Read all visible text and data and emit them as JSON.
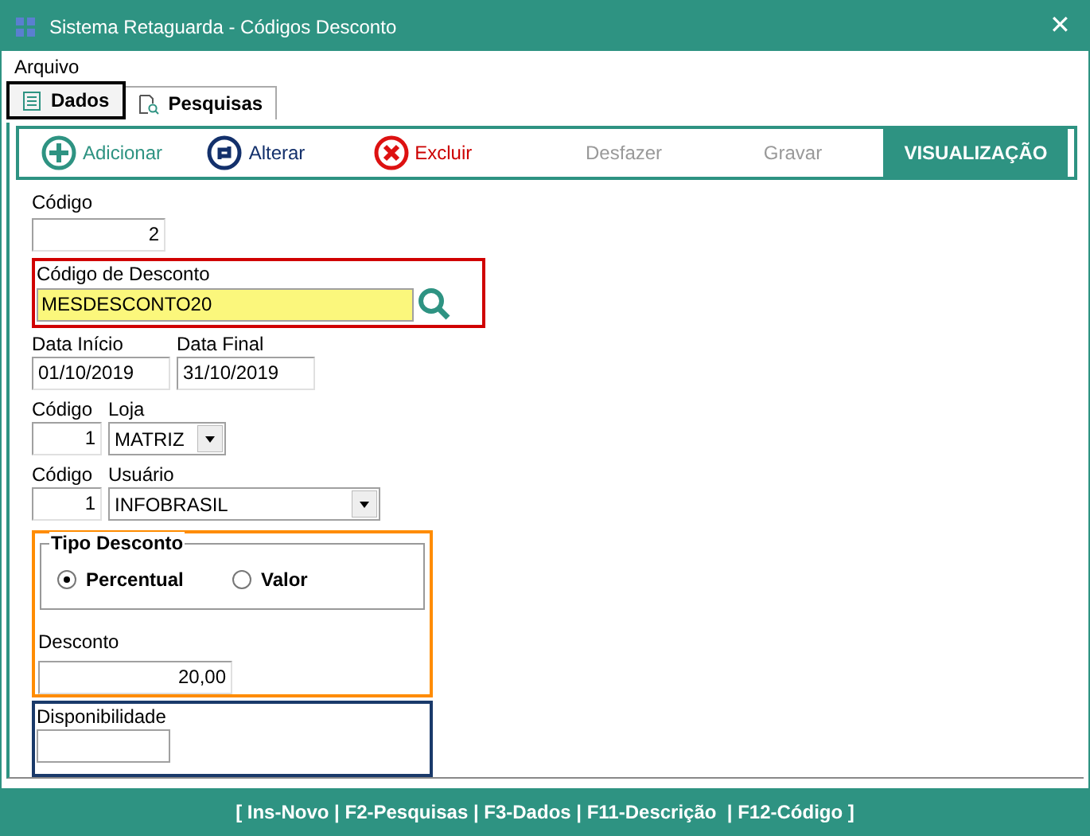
{
  "window": {
    "title": "Sistema Retaguarda - Códigos Desconto",
    "close": "✕"
  },
  "menu": [
    "Arquivo"
  ],
  "tabs": [
    {
      "label": "Dados",
      "selected": true,
      "kind": "list"
    },
    {
      "label": "Pesquisas",
      "selected": false,
      "kind": "search"
    }
  ],
  "toolbar": [
    {
      "label": "Adicionar",
      "kind": "add",
      "disabled": false
    },
    {
      "label": "Alterar",
      "kind": "edit",
      "disabled": false
    },
    {
      "label": "Excluir",
      "kind": "delete",
      "disabled": false
    },
    {
      "label": "Desfazer",
      "kind": "text",
      "disabled": true
    },
    {
      "label": "Gravar",
      "kind": "text",
      "disabled": true
    }
  ],
  "view_button": "VISUALIZAÇÃO",
  "form": {
    "codigo": {
      "label": "Código",
      "value": "2"
    },
    "codigo_desconto": {
      "label": "Código de Desconto",
      "value": "MESDESCONTO20",
      "color": "#d00000"
    },
    "data_inicio": {
      "label": "Data Início",
      "value": "01/10/2019"
    },
    "data_final": {
      "label": "Data Final",
      "value": "31/10/2019"
    },
    "loja": {
      "code_label": "Código",
      "code": "1",
      "label": "Loja",
      "value": "MATRIZ"
    },
    "usuario": {
      "code_label": "Código",
      "code": "1",
      "label": "Usuário",
      "value": "INFOBRASIL"
    },
    "tipo_desconto": {
      "title": "Tipo Desconto",
      "color": "#ff8c00",
      "options": [
        {
          "label": "Percentual",
          "selected": true
        },
        {
          "label": "Valor",
          "selected": false
        }
      ]
    },
    "desconto": {
      "label": "Desconto",
      "value": "20,00"
    },
    "disponibilidade": {
      "label": "Disponibilidade",
      "color": "#1a3a6a"
    }
  },
  "status_bar": "[ Ins-Novo | F2-Pesquisas | F3-Dados | F11-Descrição  | F12-Código ]"
}
